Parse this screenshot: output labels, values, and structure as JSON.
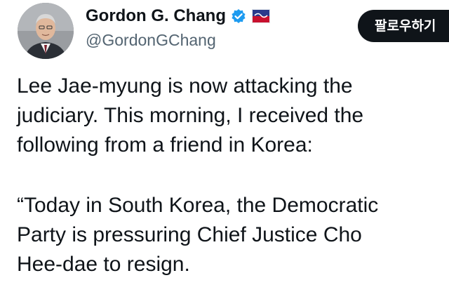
{
  "author": {
    "display_name": "Gordon G. Chang",
    "handle": "@GordonGChang",
    "verified_icon": "verified-badge-icon",
    "affiliate_icon": "flag-badge-icon"
  },
  "follow_button": {
    "label": "팔로우하기"
  },
  "tweet": {
    "paragraph1": [
      "Lee Jae-myung is now attacking the",
      "judiciary. This morning, I received the",
      "following from a friend in Korea:"
    ],
    "paragraph2": [
      "“Today in South Korea, the Democratic",
      "Party is pressuring Chief Justice Cho",
      "Hee-dae to resign."
    ]
  },
  "colors": {
    "verified_blue": "#1d9bf0",
    "handle_gray": "#536471",
    "button_bg": "#0f1419"
  }
}
